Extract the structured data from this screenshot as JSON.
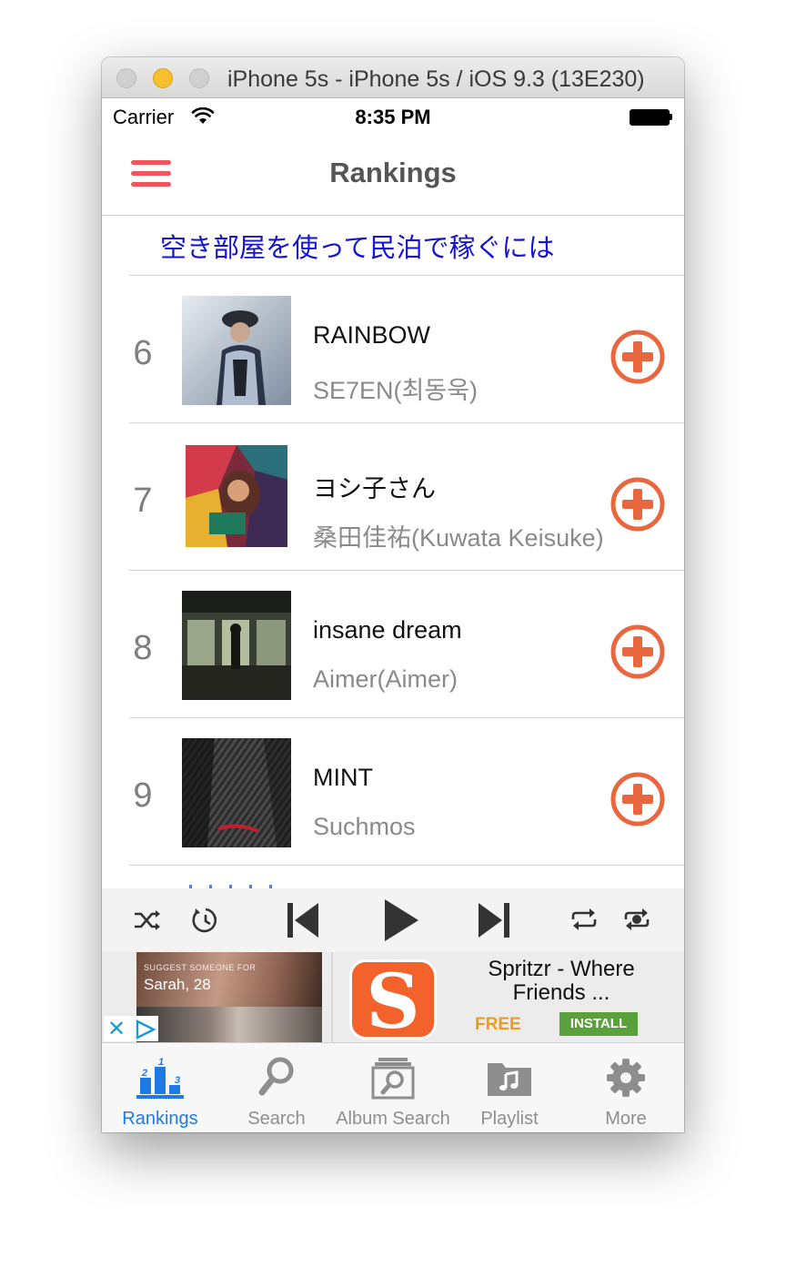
{
  "window": {
    "title": "iPhone 5s - iPhone 5s / iOS 9.3 (13E230)"
  },
  "status_bar": {
    "carrier": "Carrier",
    "time": "8:35 PM"
  },
  "nav": {
    "title": "Rankings",
    "menu_icon": "hamburger-menu-icon"
  },
  "promo_link": "空き部屋を使って民泊で稼ぐには",
  "rankings": [
    {
      "rank": "6",
      "title": "RAINBOW",
      "artist": "SE7EN(최동욱)"
    },
    {
      "rank": "7",
      "title": "ヨシ子さん",
      "artist": "桑田佳祐(Kuwata Keisuke)"
    },
    {
      "rank": "8",
      "title": "insane dream",
      "artist": "Aimer(Aimer)"
    },
    {
      "rank": "9",
      "title": "MINT",
      "artist": "Suchmos"
    }
  ],
  "player": {
    "controls": [
      "shuffle-icon",
      "sleep-timer-icon",
      "previous-track-icon",
      "play-icon",
      "next-track-icon",
      "repeat-icon",
      "repeat-one-icon"
    ]
  },
  "ad": {
    "suggest_text": "SUGGEST SOMEONE FOR",
    "profile_text": "Sarah, 28",
    "app_icon_letter": "S",
    "app_title": "Spritzr - Where Friends ...",
    "price": "FREE",
    "install_label": "INSTALL"
  },
  "tabs": [
    {
      "label": "Rankings",
      "icon": "rankings-podium-icon",
      "active": true
    },
    {
      "label": "Search",
      "icon": "search-icon",
      "active": false
    },
    {
      "label": "Album Search",
      "icon": "album-search-icon",
      "active": false
    },
    {
      "label": "Playlist",
      "icon": "playlist-folder-icon",
      "active": false
    },
    {
      "label": "More",
      "icon": "gear-icon",
      "active": false
    }
  ],
  "colors": {
    "accent_red": "#f0555d",
    "add_button_orange": "#e8673f",
    "tab_active_blue": "#1e7be6",
    "promo_blue": "#1414d2"
  }
}
